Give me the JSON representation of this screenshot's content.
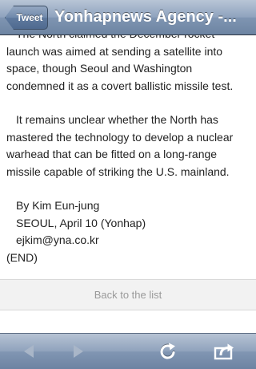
{
  "navbar": {
    "back_label": "Tweet",
    "title": "Yonhapnews Agency -..."
  },
  "article": {
    "partial_line": "The North claimed the December rocket",
    "para1_rest": "launch was aimed at sending a satellite into space, though Seoul and Washington condemned it as a covert ballistic missile test.",
    "para2": "It remains unclear whether the North has mastered the technology to develop a nuclear warhead that can be fitted on a long-range missile capable of striking the U.S. mainland.",
    "byline": "By Kim Eun-jung",
    "dateline": "SEOUL, April 10 (Yonhap)",
    "email": "ejkim@yna.co.kr",
    "end": "(END)"
  },
  "back_to_list": "Back to the list",
  "toolbar": {
    "icons": [
      "back-arrow-icon",
      "forward-arrow-icon",
      "refresh-icon",
      "share-icon"
    ],
    "colors": {
      "enabled": "#ffffff",
      "disabled": "#a9b6c8"
    }
  }
}
